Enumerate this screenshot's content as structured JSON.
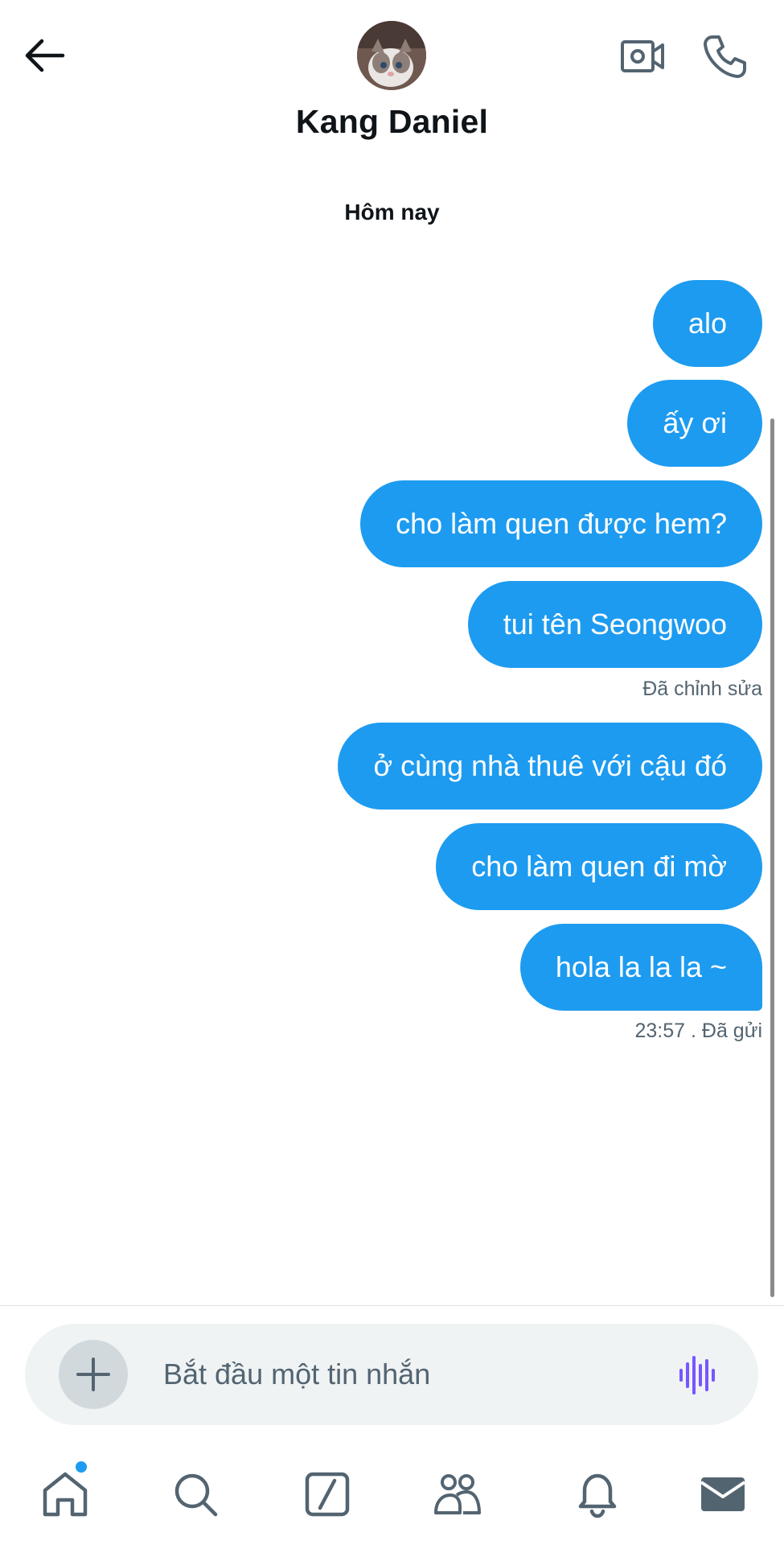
{
  "header": {
    "contact_name": "Kang Daniel"
  },
  "date_separator": "Hôm nay",
  "messages": [
    {
      "text": "alo"
    },
    {
      "text": "ấy ơi"
    },
    {
      "text": "cho làm quen được hem?"
    },
    {
      "text": "tui tên Seongwoo",
      "status": "Đã chỉnh sửa"
    },
    {
      "text": "ở cùng nhà thuê với cậu đó"
    },
    {
      "text": "cho làm quen đi mờ"
    },
    {
      "text": "hola la la la ~",
      "status": "23:57 . Đã gửi"
    }
  ],
  "composer": {
    "placeholder": "Bắt đầu một tin nhắn"
  },
  "icons": {
    "back": "back-arrow-icon",
    "video": "video-call-icon",
    "phone": "phone-icon",
    "add": "plus-icon",
    "voice": "voice-message-icon",
    "tabs": [
      "home-icon",
      "search-icon",
      "grok-icon",
      "communities-icon",
      "notifications-icon",
      "messages-icon"
    ]
  },
  "colors": {
    "bubble": "#1d9bf0",
    "voice_accent": "#7856ff",
    "notification_dot": "#1d9bf0"
  }
}
